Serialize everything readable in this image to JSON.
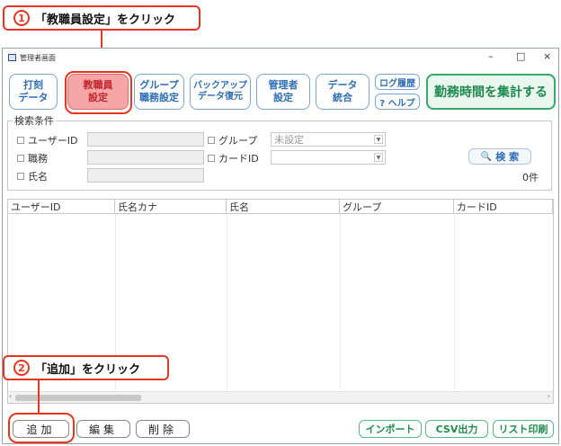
{
  "callout1": {
    "num": "1",
    "text": "「教職員設定」をクリック"
  },
  "callout2": {
    "num": "2",
    "text": "「追加」をクリック"
  },
  "window": {
    "title": "管理者画面",
    "controls": {
      "minimize": "–",
      "maximize": "□",
      "close": "×"
    }
  },
  "toolbar": {
    "punch": [
      "打刻",
      "データ"
    ],
    "staff": [
      "教職員",
      "設定"
    ],
    "group": [
      "グループ",
      "職務設定"
    ],
    "backup": [
      "バックアップ",
      "データ復元"
    ],
    "admin": [
      "管理者",
      "設定"
    ],
    "data_merge": [
      "データ",
      "統合"
    ],
    "log_history": "ログ履歴",
    "help": "? ヘルプ",
    "aggregate": "勤務時間を集計する"
  },
  "search": {
    "legend": "検索条件",
    "user_id_label": "ユーザーID",
    "job_label": "職務",
    "name_label": "氏名",
    "group_label": "グループ",
    "group_value": "未設定",
    "card_id_label": "カードID",
    "card_id_value": "",
    "search_button": "検 索",
    "count": "0件"
  },
  "table": {
    "columns": [
      "ユーザーID",
      "氏名カナ",
      "氏名",
      "グループ",
      "カードID"
    ]
  },
  "bottom": {
    "add": "追加",
    "edit": "編集",
    "delete": "削除",
    "import": "インポート",
    "csv": "CSV出力",
    "print": "リスト印刷"
  }
}
